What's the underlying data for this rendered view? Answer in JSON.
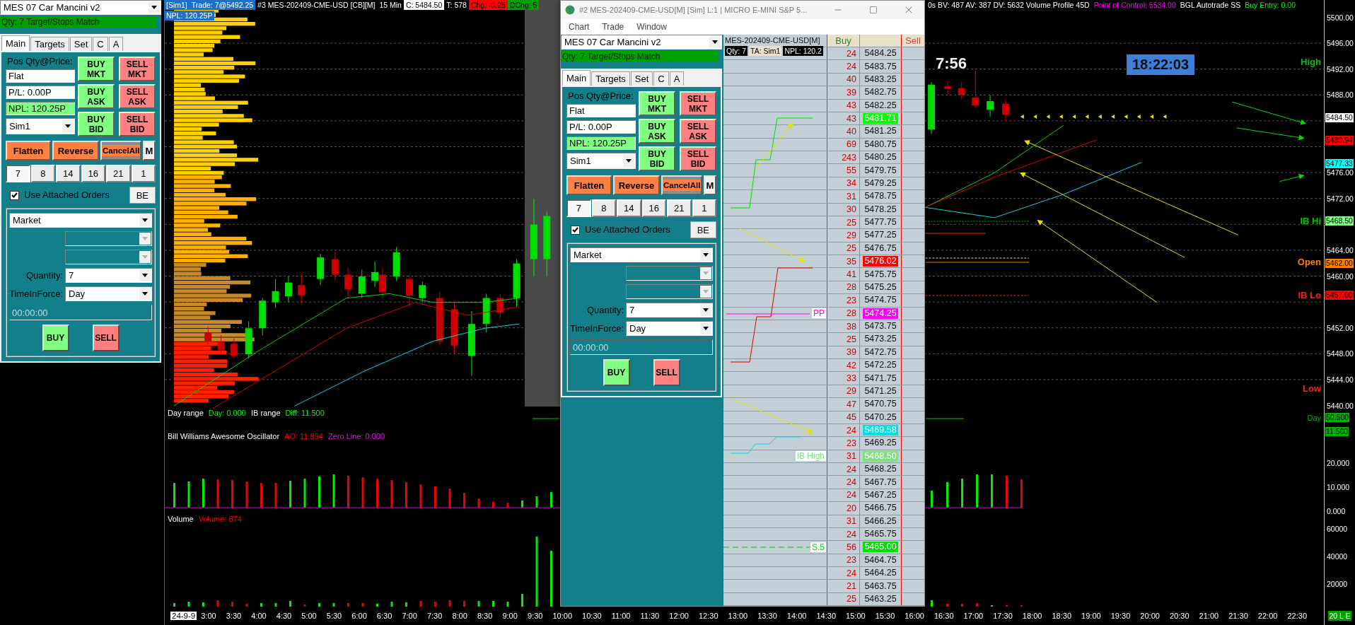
{
  "left_panel": {
    "strategy": "MES 07 Car Mancini v2",
    "status": "Qty: 7 Target/Stops Match",
    "tabs": [
      {
        "label": "Main",
        "selected": true
      },
      {
        "label": "Targets",
        "selected": false
      },
      {
        "label": "Set",
        "selected": false
      },
      {
        "label": "C",
        "selected": false
      },
      {
        "label": "A",
        "selected": false
      }
    ],
    "position_label": "Pos Qty@Price:",
    "position": "Flat",
    "pnl": "P/L: 0.00P",
    "npl": "NPL: 120.25P",
    "account": "Sim1",
    "trade_buttons": [
      {
        "label": "BUY MKT",
        "kind": "buy"
      },
      {
        "label": "SELL MKT",
        "kind": "sell"
      },
      {
        "label": "BUY ASK",
        "kind": "buy"
      },
      {
        "label": "SELL ASK",
        "kind": "sell"
      },
      {
        "label": "BUY BID",
        "kind": "buy"
      },
      {
        "label": "SELL BID",
        "kind": "sell"
      }
    ],
    "actions": [
      {
        "label": "Flatten",
        "kind": "flatten"
      },
      {
        "label": "Reverse",
        "kind": "reverse"
      },
      {
        "label": "CancelAll",
        "kind": "cancel"
      },
      {
        "label": "M",
        "kind": "plain"
      }
    ],
    "quantities": [
      {
        "label": "7",
        "selected": true
      },
      {
        "label": "8",
        "selected": false
      },
      {
        "label": "14",
        "selected": false
      },
      {
        "label": "16",
        "selected": false
      },
      {
        "label": "21",
        "selected": false
      },
      {
        "label": "1",
        "selected": false
      }
    ],
    "attached": {
      "label": "Use Attached Orders",
      "checked": true
    },
    "be": "BE",
    "order_type": "Market",
    "extra_selects": [
      {
        "disabled": true
      },
      {
        "disabled": true
      }
    ],
    "quantity_label": "Quantity:",
    "quantity": "7",
    "tif_label": "TimeInForce:",
    "tif": "Day",
    "time_placeholder": "00:00:00",
    "buy": "BUY",
    "sell": "SELL"
  },
  "chart": {
    "header": [
      {
        "text": "[Sim1]",
        "kind": "badge"
      },
      {
        "text": "Trade: 7@5492.25",
        "kind": "badge"
      },
      {
        "text": "#3 MES-202409-CME-USD [CB][M]",
        "kind": "plain"
      },
      {
        "text": "15 Min",
        "kind": "plain"
      },
      {
        "text": "C: 5484.50",
        "kind": "inverse"
      },
      {
        "text": "T: 578",
        "kind": "plain"
      },
      {
        "text": "Chg: -0.25",
        "kind": "down"
      },
      {
        "text": "DChg: 5",
        "kind": "up"
      }
    ],
    "npl": "NPL: 120.25P",
    "header_right": [
      {
        "text": "0s BV: 487 AV: 387 DV: 5632 Volume Profile 45D",
        "color": "#ffffff"
      },
      {
        "text": "Point of Control: 5534.00",
        "color": "#ff00ff"
      },
      {
        "text": "BGL Autotrade SS",
        "color": "#ffffff"
      },
      {
        "text": "Buy Entry: 0.00",
        "color": "#00ff00"
      }
    ],
    "bar_timer": "7:56",
    "clock": "18:22:03",
    "levels": [
      {
        "text": "High",
        "color": "#00c000"
      },
      {
        "text": "IB Hi",
        "color": "#00c000"
      },
      {
        "text": "Open",
        "color": "#ff8000"
      },
      {
        "text": "IB Lo",
        "color": "#ff2020"
      },
      {
        "text": "Low",
        "color": "#ff2020"
      }
    ],
    "price_ticks": [
      "5500.00",
      "5496.00",
      "5492.00",
      "5488.00",
      "5476.00",
      "5472.00",
      "5464.00",
      "5460.00",
      "5452.00",
      "5448.00",
      "5444.00",
      "5440.00"
    ],
    "price_tags": [
      {
        "text": "5484.50",
        "color": "#ffffff"
      },
      {
        "text": "5480.94",
        "color": "#ff0000"
      },
      {
        "text": "5477.33",
        "color": "#00ffff"
      },
      {
        "text": "5468.50",
        "color": "#80ff80"
      },
      {
        "text": "5462.00",
        "color": "#ff8000"
      },
      {
        "text": "5457.00",
        "color": "#ff0000"
      }
    ],
    "day_range": [
      {
        "text": "Day range",
        "color": "#ffffff"
      },
      {
        "text": "Day: 0.000",
        "color": "#00ff00"
      },
      {
        "text": "IB range",
        "color": "#ffffff"
      },
      {
        "text": "Diff: 11.500",
        "color": "#00ff00"
      }
    ],
    "day_label": "Day",
    "day_tags": [
      "50.500",
      "11.500"
    ],
    "oscillator": {
      "title": "Bill Williams Awesome Oscillator",
      "readings": [
        {
          "text": "AO: 11.894",
          "color": "#ff0000"
        },
        {
          "text": "Zero Line: 0.000",
          "color": "#ff00ff"
        }
      ],
      "ticks": [
        "20.000",
        "10.000",
        "0.000"
      ]
    },
    "volume": {
      "title": "Volume",
      "readings": [
        {
          "text": "Volume: 874",
          "color": "#ff0000"
        }
      ],
      "ticks": [
        "60000",
        "40000",
        "20000"
      ]
    },
    "time_axis": {
      "date": "24-9-9",
      "labels": [
        "3:00",
        "3:30",
        "4:00",
        "4:30",
        "5:00",
        "5:30",
        "6:00",
        "6:30",
        "7:00",
        "7:30",
        "8:00",
        "8:30",
        "9:00",
        "9:30",
        "10:00",
        "10:30",
        "11:00",
        "11:30",
        "12:00",
        "12:30",
        "13:00",
        "13:30",
        "14:00",
        "14:30",
        "15:00",
        "15:30",
        "16:00",
        "16:30",
        "17:00",
        "17:30",
        "18:00",
        "18:30",
        "19:00",
        "19:30",
        "20:00",
        "20:30",
        "21:00",
        "21:30",
        "22:00",
        "22:30"
      ],
      "status": "20 L E"
    }
  },
  "window": {
    "title": "#2 MES-202409-CME-USD[M] [Sim] L:1 | MICRO E-MINI S&P 5...",
    "menu": [
      "Chart",
      "Trade",
      "Window"
    ],
    "order_panel": {
      "strategy": "MES 07 Car Mancini v2",
      "status": "Qty: 7 Target/Stops Match",
      "tabs": [
        {
          "label": "Main",
          "selected": true
        },
        {
          "label": "Targets",
          "selected": false
        },
        {
          "label": "Set",
          "selected": false
        },
        {
          "label": "C",
          "selected": false
        },
        {
          "label": "A",
          "selected": false
        }
      ],
      "position_label": "Pos Qty@Price:",
      "position": "Flat",
      "pnl": "P/L: 0.00P",
      "npl": "NPL: 120.25P",
      "account": "Sim1",
      "trade_buttons": [
        {
          "label": "BUY MKT",
          "kind": "buy"
        },
        {
          "label": "SELL MKT",
          "kind": "sell"
        },
        {
          "label": "BUY ASK",
          "kind": "buy"
        },
        {
          "label": "SELL ASK",
          "kind": "sell"
        },
        {
          "label": "BUY BID",
          "kind": "buy"
        },
        {
          "label": "SELL BID",
          "kind": "sell"
        }
      ],
      "actions": [
        {
          "label": "Flatten",
          "kind": "flatten"
        },
        {
          "label": "Reverse",
          "kind": "reverse"
        },
        {
          "label": "CancelAll",
          "kind": "cancel"
        },
        {
          "label": "M",
          "kind": "plain"
        }
      ],
      "quantities": [
        {
          "label": "7",
          "selected": true
        },
        {
          "label": "8",
          "selected": false
        },
        {
          "label": "14",
          "selected": false
        },
        {
          "label": "16",
          "selected": false
        },
        {
          "label": "21",
          "selected": false
        },
        {
          "label": "1",
          "selected": false
        }
      ],
      "attached": {
        "label": "Use Attached Orders",
        "checked": true
      },
      "be": "BE",
      "order_type": "Market",
      "extra_selects": [
        {
          "disabled": true
        },
        {
          "disabled": true
        }
      ],
      "quantity_label": "Quantity:",
      "quantity": "7",
      "tif_label": "TimeInForce:",
      "tif": "Day",
      "time_placeholder": "00:00:00",
      "buy": "BUY",
      "sell": "SELL"
    },
    "ladder": {
      "instrument": "MES-202409-CME-USD[M]",
      "info": [
        {
          "text": "Qty: 7",
          "kind": "dark"
        },
        {
          "text": "TA: Sim1",
          "kind": "light"
        },
        {
          "text": "NPL: 120.2",
          "kind": "dark"
        }
      ],
      "buy_header": "Buy",
      "sell_header": "Sell",
      "rows": [
        {
          "price": "5484.25",
          "buy": "24"
        },
        {
          "price": "5483.75",
          "buy": "24"
        },
        {
          "price": "5483.25",
          "buy": "40"
        },
        {
          "price": "5482.75",
          "buy": "39"
        },
        {
          "price": "5482.25",
          "buy": "43"
        },
        {
          "price": "5481.71",
          "buy": "43",
          "color": "#00ff00"
        },
        {
          "price": "5481.25",
          "buy": "40"
        },
        {
          "price": "5480.75",
          "buy": "69"
        },
        {
          "price": "5480.25",
          "buy": "243"
        },
        {
          "price": "5479.75",
          "buy": "55"
        },
        {
          "price": "5479.25",
          "buy": "34"
        },
        {
          "price": "5478.75",
          "buy": "31"
        },
        {
          "price": "5478.25",
          "buy": "30"
        },
        {
          "price": "5477.75",
          "buy": "25"
        },
        {
          "price": "5477.25",
          "buy": "29"
        },
        {
          "price": "5476.75",
          "buy": "25"
        },
        {
          "price": "5476.02",
          "buy": "35",
          "color": "#ff0000"
        },
        {
          "price": "5475.75",
          "buy": "41"
        },
        {
          "price": "5475.25",
          "buy": "28"
        },
        {
          "price": "5474.75",
          "buy": "23"
        },
        {
          "price": "5474.25",
          "buy": "28",
          "color": "#ff00ff",
          "note": "PP"
        },
        {
          "price": "5473.75",
          "buy": "38"
        },
        {
          "price": "5473.25",
          "buy": "25"
        },
        {
          "price": "5472.75",
          "buy": "39"
        },
        {
          "price": "5472.25",
          "buy": "42"
        },
        {
          "price": "5471.75",
          "buy": "33"
        },
        {
          "price": "5471.25",
          "buy": "29"
        },
        {
          "price": "5470.75",
          "buy": "47"
        },
        {
          "price": "5470.25",
          "buy": "45"
        },
        {
          "price": "5469.58",
          "buy": "24",
          "color": "#00e0e0"
        },
        {
          "price": "5469.25",
          "buy": "23"
        },
        {
          "price": "5468.50",
          "buy": "31",
          "color": "#80e080",
          "note": "IB High"
        },
        {
          "price": "5468.25",
          "buy": "24"
        },
        {
          "price": "5467.75",
          "buy": "24"
        },
        {
          "price": "5467.25",
          "buy": "24"
        },
        {
          "price": "5466.75",
          "buy": "20"
        },
        {
          "price": "5466.25",
          "buy": "31"
        },
        {
          "price": "5465.75",
          "buy": "24"
        },
        {
          "price": "5465.00",
          "buy": "56",
          "color": "#00e000",
          "note": "S.5"
        },
        {
          "price": "5464.75",
          "buy": "23"
        },
        {
          "price": "5464.25",
          "buy": "24"
        },
        {
          "price": "5463.75",
          "buy": "21"
        },
        {
          "price": "5463.25",
          "buy": "25"
        }
      ]
    }
  }
}
